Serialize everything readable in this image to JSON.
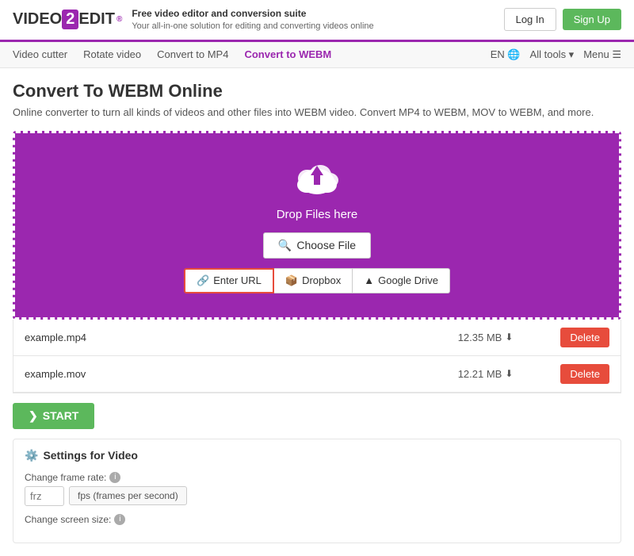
{
  "header": {
    "logo_text": "VIDEO",
    "logo_two": "2",
    "logo_edit": "EDIT",
    "logo_tagline_bold": "Free video editor and conversion suite",
    "logo_tagline": "Your all-in-one solution for editing and converting videos online",
    "login_label": "Log In",
    "signup_label": "Sign Up"
  },
  "nav": {
    "items": [
      {
        "label": "Video cutter",
        "id": "video-cutter"
      },
      {
        "label": "Rotate video",
        "id": "rotate-video"
      },
      {
        "label": "Convert to MP4",
        "id": "convert-mp4"
      },
      {
        "label": "Convert to WEBM",
        "id": "convert-webm"
      }
    ],
    "right_items": [
      {
        "label": "EN 🌐",
        "id": "lang"
      },
      {
        "label": "All tools ▾",
        "id": "all-tools"
      },
      {
        "label": "Menu ☰",
        "id": "menu"
      }
    ]
  },
  "main": {
    "page_title": "Convert To WEBM Online",
    "page_desc": "Online converter to turn all kinds of videos and other files into WEBM video. Convert MP4 to WEBM, MOV to WEBM, and more.",
    "upload": {
      "drop_text": "Drop Files here",
      "choose_file_label": "Choose File",
      "url_label": "Enter URL",
      "dropbox_label": "Dropbox",
      "gdrive_label": "Google Drive"
    },
    "files": [
      {
        "name": "example.mp4",
        "size": "12.35 MB"
      },
      {
        "name": "example.mov",
        "size": "12.21 MB"
      }
    ],
    "delete_label": "Delete",
    "start_label": "START",
    "settings": {
      "title": "Settings for Video",
      "frame_rate_label": "Change frame rate:",
      "frame_rate_placeholder": "frz",
      "frame_rate_unit": "fps (frames per second)",
      "screen_size_label": "Change screen size:"
    }
  }
}
